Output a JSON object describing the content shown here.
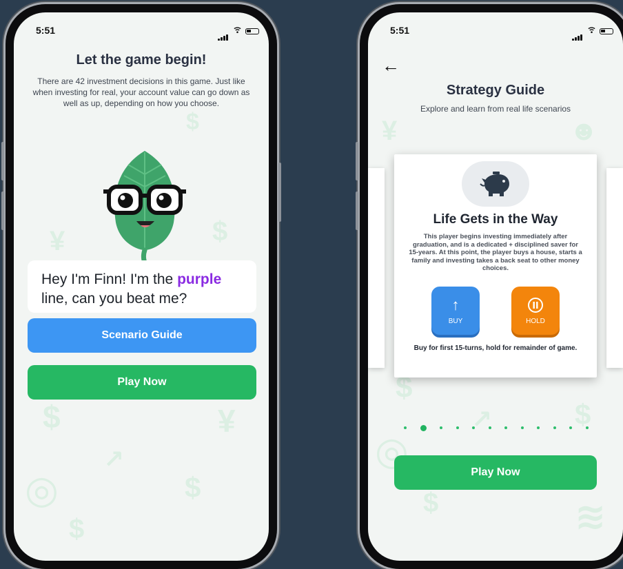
{
  "status": {
    "time": "5:51"
  },
  "left": {
    "title": "Let the game begin!",
    "description": "There are 42 investment decisions in this game. Just like when investing for real, your account value can go down as well as up, depending on how you choose.",
    "speech": {
      "part1": "Hey I'm Finn! I'm the ",
      "highlight": "purple",
      "part2": " line, can you beat me?"
    },
    "scenario_button": "Scenario Guide",
    "play_button": "Play Now"
  },
  "right": {
    "back_icon": "←",
    "title": "Strategy Guide",
    "subtitle": "Explore and learn from real life scenarios",
    "card": {
      "icon": "piggy-bank-icon",
      "title": "Life Gets in the Way",
      "description": "This player begins investing immediately after graduation, and is a dedicated + disciplined saver for 15-years.  At this point, the player buys a house, starts a family and investing takes a back seat to other money choices.",
      "buy_label": "BUY",
      "hold_label": "HOLD",
      "footer": "Buy for first 15-turns, hold for remainder of game."
    },
    "pagination": {
      "total": 12,
      "current": 2
    },
    "play_button": "Play Now"
  },
  "colors": {
    "background": "#2b3d4f",
    "blue": "#3d96f3",
    "green": "#26b863",
    "purple": "#8a2be2",
    "orange": "#f3850c"
  }
}
